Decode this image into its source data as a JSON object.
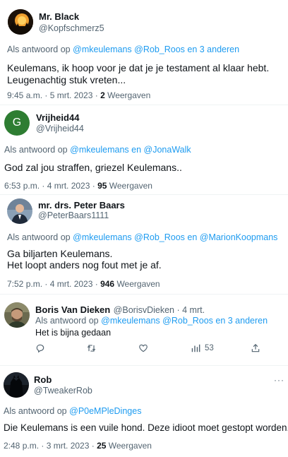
{
  "tweets": [
    {
      "name": "Mr. Black",
      "handle": "@Kopfschmerz5",
      "reply_prefix": "Als antwoord op",
      "reply_links": "@mkeulemans @Rob_Roos  en 3 anderen",
      "body_line1": "Keulemans, ik hoop voor je dat je je testament al klaar hebt.",
      "body_line2": "Leugenachtig stuk vreten...",
      "time": "9:45 a.m. · 5 mrt. 2023 ·",
      "views_count": "2",
      "views_label": "Weergaven"
    },
    {
      "name": "Vrijheid44",
      "handle": "@Vrijheid44",
      "avatar_letter": "G",
      "avatar_color": "#2e7d32",
      "reply_prefix": "Als antwoord op",
      "reply_links": "@mkeulemans en @JonaWalk",
      "body_line1": "God zal jou straffen, griezel Keulemans..",
      "time": "6:53 p.m. · 4 mrt. 2023 ·",
      "views_count": "95",
      "views_label": "Weergaven"
    },
    {
      "name": "mr. drs. Peter Baars",
      "handle": "@PeterBaars1111",
      "reply_prefix": "Als antwoord op",
      "reply_links": "@mkeulemans @Rob_Roos en @MarionKoopmans",
      "body_line1": "Ga biljarten Keulemans.",
      "body_line2": "Het loopt anders nog fout met je af.",
      "time": "7:52 p.m. · 4 mrt. 2023 ·",
      "views_count": "946",
      "views_label": "Weergaven"
    },
    {
      "name": "Boris Van Dieken",
      "handle_date": "@BorisvDieken · 4 mrt.",
      "reply_prefix": "Als antwoord op",
      "reply_links": "@mkeulemans @Rob_Roos  en 3 anderen",
      "body_line1": "Het is bijna gedaan",
      "analytics_count": "53"
    },
    {
      "name": "Rob",
      "handle": "@TweakerRob",
      "more_label": "···",
      "reply_prefix": "Als antwoord op",
      "reply_links": "@P0eMPleDinges",
      "body_line1": "Die Keulemans is een vuile hond. Deze idioot moet gestopt worden.",
      "time": "2:48 p.m. · 3 mrt. 2023 ·",
      "views_count": "25",
      "views_label": "Weergaven"
    }
  ],
  "icons": {
    "reply": "reply-icon",
    "retweet": "retweet-icon",
    "like": "like-icon",
    "analytics": "analytics-icon",
    "share": "share-icon"
  },
  "colors": {
    "link": "#1d9bf0",
    "secondary_text": "#536471",
    "primary_text": "#0f1419"
  }
}
